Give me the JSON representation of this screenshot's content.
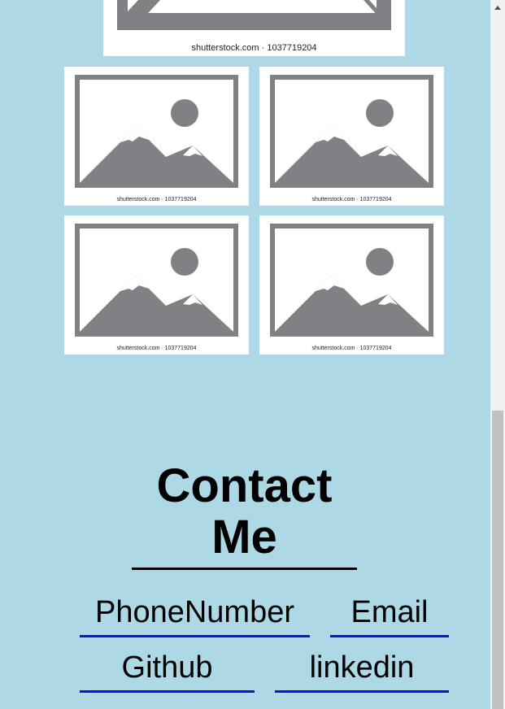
{
  "images": [
    {
      "caption": "shutterstock.com · 1037719204"
    },
    {
      "caption": "shutterstock.com · 1037719204"
    },
    {
      "caption": "shutterstock.com · 1037719204"
    },
    {
      "caption": "shutterstock.com · 1037719204"
    },
    {
      "caption": "shutterstock.com · 1037719204"
    }
  ],
  "contact": {
    "title": "Contact Me",
    "links": [
      "PhoneNumber",
      "Email",
      "Github",
      "linkedin"
    ]
  },
  "colors": {
    "background": "#add8e6",
    "placeholder_gray": "#808184",
    "link_underline": "#0a14d0"
  }
}
